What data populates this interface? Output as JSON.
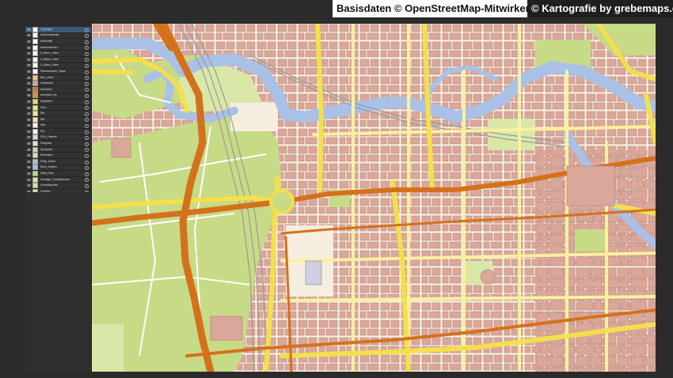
{
  "credits": {
    "osm": "Basisdaten © OpenStreetMap-Mitwirkende",
    "grebemaps": "© Kartografie by grebemaps.de"
  },
  "layers_panel": {
    "selected_index": 0,
    "layers": [
      {
        "name": "Copyright",
        "color": "#ffffff"
      },
      {
        "name": "Kartenmaterials",
        "color": "#ffffff"
      },
      {
        "name": "Kartentitel",
        "color": "#ffffff"
      },
      {
        "name": "Kartenrahmen",
        "color": "#ffffff"
      },
      {
        "name": "S_Bahn_Linien",
        "color": "#ffffff"
      },
      {
        "name": "U_Bahn_Linien",
        "color": "#ffffff"
      },
      {
        "name": "U_Bahn_Linien",
        "color": "#ffffff"
      },
      {
        "name": "Strassenbahn_Linien",
        "color": "#ffffff"
      },
      {
        "name": "Bus_Linien",
        "color": "#f2c27a"
      },
      {
        "name": "Gebaeude",
        "color": "#d9a595"
      },
      {
        "name": "Autobahn",
        "color": "#d9731a"
      },
      {
        "name": "Autobahn_etc",
        "color": "#e08a3a"
      },
      {
        "name": "Hauptfahr",
        "color": "#f5d94a"
      },
      {
        "name": "Fahr",
        "color": "#f7e67a"
      },
      {
        "name": "Rfa",
        "color": "#f3ec9a"
      },
      {
        "name": "Rfa",
        "color": "#f3ec9a"
      },
      {
        "name": "Wfa",
        "color": "#ffffff"
      },
      {
        "name": "Pfd",
        "color": "#ffffff"
      },
      {
        "name": "PSD_Flaeche",
        "color": "#e9d7c7"
      },
      {
        "name": "Parkplatz",
        "color": "#e7ddd0"
      },
      {
        "name": "Sportplatz",
        "color": "#c9df9a"
      },
      {
        "name": "Steinmeer",
        "color": "#d9d9d9"
      },
      {
        "name": "Fluss_Kanal",
        "color": "#a9bfe0"
      },
      {
        "name": "Bach_Graben",
        "color": "#a9bfe0"
      },
      {
        "name": "Wald_Park",
        "color": "#c3d98a"
      },
      {
        "name": "Sonstige_Gruenflaechen",
        "color": "#d6e6a8"
      },
      {
        "name": "Gruenflaechen",
        "color": "#cfe3a0"
      },
      {
        "name": "Friedhof",
        "color": "#c9d9b0"
      },
      {
        "name": "Gewaesser",
        "color": "#a9bfe0"
      },
      {
        "name": "Siedlung",
        "color": "#f6efdf"
      },
      {
        "name": "Hintergrund",
        "color": "#ffffff"
      }
    ]
  },
  "map": {
    "colors": {
      "background": "#f6efdf",
      "building": "#dba79a",
      "building_outline": "#b98a80",
      "water": "#a9c1e6",
      "park": "#c7da86",
      "light_green": "#d9e8a8",
      "highway": "#d4711c",
      "primary_road": "#f4df4c",
      "secondary_road": "#fbf0a0",
      "rail": "#9a9a9a",
      "footway": "#ffffff"
    }
  }
}
